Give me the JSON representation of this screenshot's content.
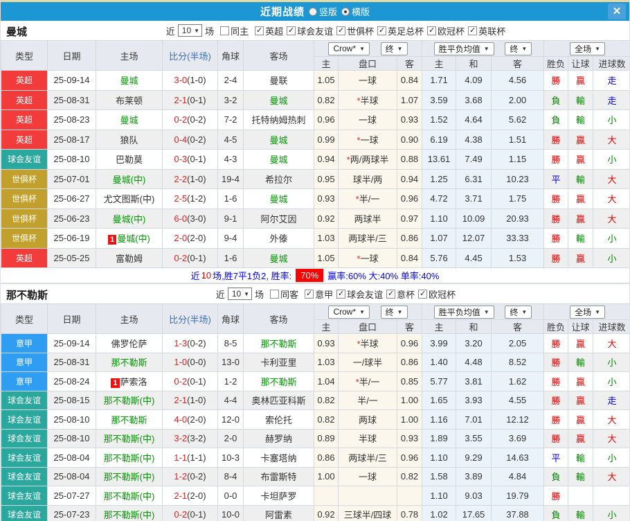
{
  "titlebar": {
    "title": "近期战绩",
    "radio_vertical": "竖版",
    "radio_horizontal": "横版",
    "close": "✕"
  },
  "icons": {
    "caret": "▼",
    "check": "✓"
  },
  "columns": {
    "type": "类型",
    "date": "日期",
    "home": "主场",
    "score": "比分(半场)",
    "corner": "角球",
    "away": "客场",
    "sub": [
      "主",
      "盘口",
      "客",
      "主",
      "和",
      "客",
      "胜负",
      "让球",
      "进球数"
    ]
  },
  "dropdowns": {
    "bookmaker": "Crow*",
    "final_a": "终",
    "avg": "胜平负均值",
    "final_b": "终",
    "scope": "全场"
  },
  "league_colors": {
    "英超": "#f23c3c",
    "球会友谊": "#2aa89d",
    "世俱杯": "#c2a02e",
    "意甲": "#2e9df2"
  },
  "result_colors": {
    "r": "#e60000",
    "g": "#008800",
    "b": "#0000e6"
  },
  "tints": {
    "handicap": "#fcf7ed",
    "odds": "#eaf3fa"
  },
  "sections": [
    {
      "team": "曼城",
      "filter": {
        "near": "近",
        "count": "10",
        "games": "场",
        "same": "同主",
        "leagues": [
          "英超",
          "球会友谊",
          "世俱杯",
          "英足总杯",
          "欧冠杯",
          "英联杯"
        ]
      },
      "rows": [
        {
          "type": "英超",
          "date": "25-09-14",
          "home": "曼城",
          "home_green": true,
          "home_badge": false,
          "score": "3-0",
          "half": "(1-0)",
          "corner": "2-4",
          "away": "曼联",
          "away_green": false,
          "hh": "1.05",
          "star": false,
          "line": "一球",
          "ha": "0.84",
          "oh": "1.71",
          "od": "4.09",
          "oa": "4.56",
          "wl": "勝",
          "wlc": "r",
          "hc": "贏",
          "hcc": "r",
          "gl": "走",
          "glc": "b"
        },
        {
          "type": "英超",
          "date": "25-08-31",
          "home": "布莱顿",
          "home_green": false,
          "home_badge": false,
          "score": "2-1",
          "half": "(0-1)",
          "corner": "3-2",
          "away": "曼城",
          "away_green": true,
          "hh": "0.82",
          "star": true,
          "line": "半球",
          "ha": "1.07",
          "oh": "3.59",
          "od": "3.68",
          "oa": "2.00",
          "wl": "負",
          "wlc": "g",
          "hc": "輸",
          "hcc": "g",
          "gl": "走",
          "glc": "b"
        },
        {
          "type": "英超",
          "date": "25-08-23",
          "home": "曼城",
          "home_green": true,
          "home_badge": false,
          "score": "0-2",
          "half": "(0-2)",
          "corner": "7-2",
          "away": "托特纳姆热刺",
          "away_green": false,
          "hh": "0.96",
          "star": false,
          "line": "一球",
          "ha": "0.93",
          "oh": "1.52",
          "od": "4.64",
          "oa": "5.62",
          "wl": "負",
          "wlc": "g",
          "hc": "輸",
          "hcc": "g",
          "gl": "小",
          "glc": "g"
        },
        {
          "type": "英超",
          "date": "25-08-17",
          "home": "狼队",
          "home_green": false,
          "home_badge": false,
          "score": "0-4",
          "half": "(0-2)",
          "corner": "4-5",
          "away": "曼城",
          "away_green": true,
          "hh": "0.99",
          "star": true,
          "line": "一球",
          "ha": "0.90",
          "oh": "6.19",
          "od": "4.38",
          "oa": "1.51",
          "wl": "勝",
          "wlc": "r",
          "hc": "贏",
          "hcc": "r",
          "gl": "大",
          "glc": "r"
        },
        {
          "type": "球会友谊",
          "date": "25-08-10",
          "home": "巴勒莫",
          "home_green": false,
          "home_badge": false,
          "score": "0-3",
          "half": "(0-1)",
          "corner": "4-3",
          "away": "曼城",
          "away_green": true,
          "hh": "0.94",
          "star": true,
          "line": "两/两球半",
          "ha": "0.88",
          "oh": "13.61",
          "od": "7.49",
          "oa": "1.15",
          "wl": "勝",
          "wlc": "r",
          "hc": "贏",
          "hcc": "r",
          "gl": "小",
          "glc": "g"
        },
        {
          "type": "世俱杯",
          "date": "25-07-01",
          "home": "曼城(中)",
          "home_green": true,
          "home_badge": false,
          "score": "2-2",
          "half": "(1-0)",
          "corner": "19-4",
          "away": "希拉尔",
          "away_green": false,
          "hh": "0.95",
          "star": false,
          "line": "球半/两",
          "ha": "0.94",
          "oh": "1.25",
          "od": "6.31",
          "oa": "10.23",
          "wl": "平",
          "wlc": "b",
          "hc": "輸",
          "hcc": "g",
          "gl": "大",
          "glc": "r"
        },
        {
          "type": "世俱杯",
          "date": "25-06-27",
          "home": "尤文图斯(中)",
          "home_green": false,
          "home_badge": false,
          "score": "2-5",
          "half": "(1-2)",
          "corner": "1-6",
          "away": "曼城",
          "away_green": true,
          "hh": "0.93",
          "star": true,
          "line": "半/一",
          "ha": "0.96",
          "oh": "4.72",
          "od": "3.71",
          "oa": "1.75",
          "wl": "勝",
          "wlc": "r",
          "hc": "贏",
          "hcc": "r",
          "gl": "大",
          "glc": "r"
        },
        {
          "type": "世俱杯",
          "date": "25-06-23",
          "home": "曼城(中)",
          "home_green": true,
          "home_badge": false,
          "score": "6-0",
          "half": "(3-0)",
          "corner": "9-1",
          "away": "阿尔艾因",
          "away_green": false,
          "hh": "0.92",
          "star": false,
          "line": "两球半",
          "ha": "0.97",
          "oh": "1.10",
          "od": "10.09",
          "oa": "20.93",
          "wl": "勝",
          "wlc": "r",
          "hc": "贏",
          "hcc": "r",
          "gl": "大",
          "glc": "r"
        },
        {
          "type": "世俱杯",
          "date": "25-06-19",
          "home": "曼城(中)",
          "home_green": true,
          "home_badge": true,
          "score": "2-0",
          "half": "(2-0)",
          "corner": "9-4",
          "away": "外傣",
          "away_green": false,
          "hh": "1.03",
          "star": false,
          "line": "两球半/三",
          "ha": "0.86",
          "oh": "1.07",
          "od": "12.07",
          "oa": "33.33",
          "wl": "勝",
          "wlc": "r",
          "hc": "輸",
          "hcc": "g",
          "gl": "小",
          "glc": "g"
        },
        {
          "type": "英超",
          "date": "25-05-25",
          "home": "富勒姆",
          "home_green": false,
          "home_badge": false,
          "score": "0-2",
          "half": "(0-1)",
          "corner": "1-6",
          "away": "曼城",
          "away_green": true,
          "hh": "1.05",
          "star": true,
          "line": "一球",
          "ha": "0.84",
          "oh": "5.76",
          "od": "4.45",
          "oa": "1.53",
          "wl": "勝",
          "wlc": "r",
          "hc": "贏",
          "hcc": "r",
          "gl": "小",
          "glc": "g"
        }
      ],
      "summary": {
        "pre": "近",
        "count": "10",
        "mid": "场,胜7平1负2, 胜率:",
        "rate": "70%",
        "rest": "赢率:60% 大:40% 单率:40%"
      }
    },
    {
      "team": "那不勒斯",
      "filter": {
        "near": "近",
        "count": "10",
        "games": "场",
        "same": "同客",
        "leagues": [
          "意甲",
          "球会友谊",
          "意杯",
          "欧冠杯"
        ]
      },
      "rows": [
        {
          "type": "意甲",
          "date": "25-09-14",
          "home": "佛罗伦萨",
          "home_green": false,
          "home_badge": false,
          "score": "1-3",
          "half": "(0-2)",
          "corner": "8-5",
          "away": "那不勒斯",
          "away_green": true,
          "hh": "0.93",
          "star": true,
          "line": "半球",
          "ha": "0.96",
          "oh": "3.99",
          "od": "3.20",
          "oa": "2.05",
          "wl": "勝",
          "wlc": "r",
          "hc": "贏",
          "hcc": "r",
          "gl": "大",
          "glc": "r"
        },
        {
          "type": "意甲",
          "date": "25-08-31",
          "home": "那不勒斯",
          "home_green": true,
          "home_badge": false,
          "score": "1-0",
          "half": "(0-0)",
          "corner": "13-0",
          "away": "卡利亚里",
          "away_green": false,
          "hh": "1.03",
          "star": false,
          "line": "一/球半",
          "ha": "0.86",
          "oh": "1.40",
          "od": "4.48",
          "oa": "8.52",
          "wl": "勝",
          "wlc": "r",
          "hc": "輸",
          "hcc": "g",
          "gl": "小",
          "glc": "g"
        },
        {
          "type": "意甲",
          "date": "25-08-24",
          "home": "萨索洛",
          "home_green": false,
          "home_badge": true,
          "score": "0-2",
          "half": "(0-1)",
          "corner": "1-2",
          "away": "那不勒斯",
          "away_green": true,
          "hh": "1.04",
          "star": true,
          "line": "半/一",
          "ha": "0.85",
          "oh": "5.77",
          "od": "3.81",
          "oa": "1.62",
          "wl": "勝",
          "wlc": "r",
          "hc": "贏",
          "hcc": "r",
          "gl": "小",
          "glc": "g"
        },
        {
          "type": "球会友谊",
          "date": "25-08-15",
          "home": "那不勒斯(中)",
          "home_green": true,
          "home_badge": false,
          "score": "2-1",
          "half": "(1-0)",
          "corner": "4-4",
          "away": "奥林匹亚科斯",
          "away_green": false,
          "hh": "0.82",
          "star": false,
          "line": "半/一",
          "ha": "1.00",
          "oh": "1.65",
          "od": "3.93",
          "oa": "4.55",
          "wl": "勝",
          "wlc": "r",
          "hc": "贏",
          "hcc": "r",
          "gl": "走",
          "glc": "b"
        },
        {
          "type": "球会友谊",
          "date": "25-08-10",
          "home": "那不勒斯",
          "home_green": true,
          "home_badge": false,
          "score": "4-0",
          "half": "(2-0)",
          "corner": "12-0",
          "away": "索伦托",
          "away_green": false,
          "hh": "0.82",
          "star": false,
          "line": "两球",
          "ha": "1.00",
          "oh": "1.16",
          "od": "7.01",
          "oa": "12.12",
          "wl": "勝",
          "wlc": "r",
          "hc": "贏",
          "hcc": "r",
          "gl": "大",
          "glc": "r"
        },
        {
          "type": "球会友谊",
          "date": "25-08-10",
          "home": "那不勒斯(中)",
          "home_green": true,
          "home_badge": false,
          "score": "3-2",
          "half": "(3-2)",
          "corner": "2-0",
          "away": "赫罗纳",
          "away_green": false,
          "hh": "0.89",
          "star": false,
          "line": "半球",
          "ha": "0.93",
          "oh": "1.89",
          "od": "3.55",
          "oa": "3.69",
          "wl": "勝",
          "wlc": "r",
          "hc": "贏",
          "hcc": "r",
          "gl": "大",
          "glc": "r"
        },
        {
          "type": "球会友谊",
          "date": "25-08-04",
          "home": "那不勒斯(中)",
          "home_green": true,
          "home_badge": false,
          "score": "1-1",
          "half": "(1-1)",
          "corner": "10-3",
          "away": "卡塞塔纳",
          "away_green": false,
          "hh": "0.86",
          "star": false,
          "line": "两球半/三",
          "ha": "0.96",
          "oh": "1.10",
          "od": "9.29",
          "oa": "14.63",
          "wl": "平",
          "wlc": "b",
          "hc": "輸",
          "hcc": "g",
          "gl": "小",
          "glc": "g"
        },
        {
          "type": "球会友谊",
          "date": "25-08-04",
          "home": "那不勒斯(中)",
          "home_green": true,
          "home_badge": false,
          "score": "1-2",
          "half": "(0-2)",
          "corner": "8-4",
          "away": "布雷斯特",
          "away_green": false,
          "hh": "1.00",
          "star": false,
          "line": "一球",
          "ha": "0.82",
          "oh": "1.58",
          "od": "3.89",
          "oa": "4.84",
          "wl": "負",
          "wlc": "g",
          "hc": "輸",
          "hcc": "g",
          "gl": "大",
          "glc": "r"
        },
        {
          "type": "球会友谊",
          "date": "25-07-27",
          "home": "那不勒斯(中)",
          "home_green": true,
          "home_badge": false,
          "score": "2-1",
          "half": "(2-0)",
          "corner": "0-0",
          "away": "卡坦萨罗",
          "away_green": false,
          "hh": "",
          "star": false,
          "line": "",
          "ha": "",
          "oh": "1.10",
          "od": "9.03",
          "oa": "19.79",
          "wl": "勝",
          "wlc": "r",
          "hc": "",
          "hcc": "r",
          "gl": "",
          "glc": "r"
        },
        {
          "type": "球会友谊",
          "date": "25-07-23",
          "home": "那不勒斯(中)",
          "home_green": true,
          "home_badge": false,
          "score": "0-2",
          "half": "(0-1)",
          "corner": "10-0",
          "away": "阿雷素",
          "away_green": false,
          "hh": "0.92",
          "star": false,
          "line": "三球半/四球",
          "ha": "0.78",
          "oh": "1.02",
          "od": "17.65",
          "oa": "37.88",
          "wl": "負",
          "wlc": "g",
          "hc": "輸",
          "hcc": "g",
          "gl": "小",
          "glc": "g"
        }
      ]
    }
  ]
}
